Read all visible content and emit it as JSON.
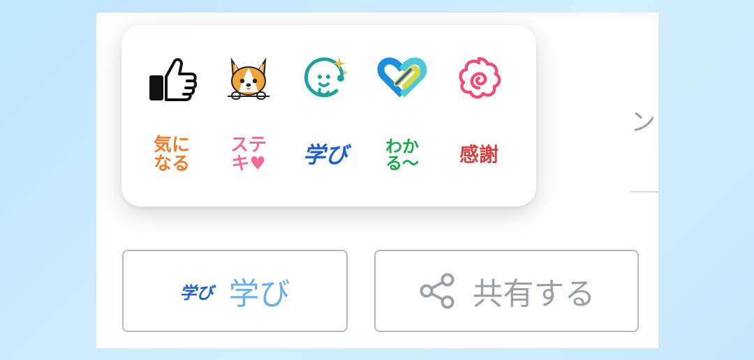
{
  "background_text": "ン",
  "reactions": {
    "icons": [
      {
        "name": "thumbs-up-icon"
      },
      {
        "name": "corgi-dog-icon"
      },
      {
        "name": "sparkle-smile-icon"
      },
      {
        "name": "heart-link-icon"
      },
      {
        "name": "swirl-flower-icon"
      }
    ],
    "stickers": [
      {
        "name": "sticker-kininaru",
        "line1": "気に",
        "line2": "なる",
        "color": "#f47b2a"
      },
      {
        "name": "sticker-suteki",
        "line1": "ステ",
        "line2": "キ",
        "color": "#f46a93"
      },
      {
        "name": "sticker-manabi",
        "line1": "学び",
        "line2": "",
        "color": "#1a62d6"
      },
      {
        "name": "sticker-wakaru",
        "line1": "わか",
        "line2": "る〜",
        "color": "#19a84a"
      },
      {
        "name": "sticker-kansha",
        "line1": "感謝",
        "line2": "",
        "color": "#d9403e"
      }
    ]
  },
  "buttons": {
    "manabi": {
      "icon_text": "学び",
      "label": "学び",
      "color": "#6aaef0",
      "icon_color": "#1a62d6"
    },
    "share": {
      "label": "共有する",
      "color": "#9aa0a6"
    }
  }
}
